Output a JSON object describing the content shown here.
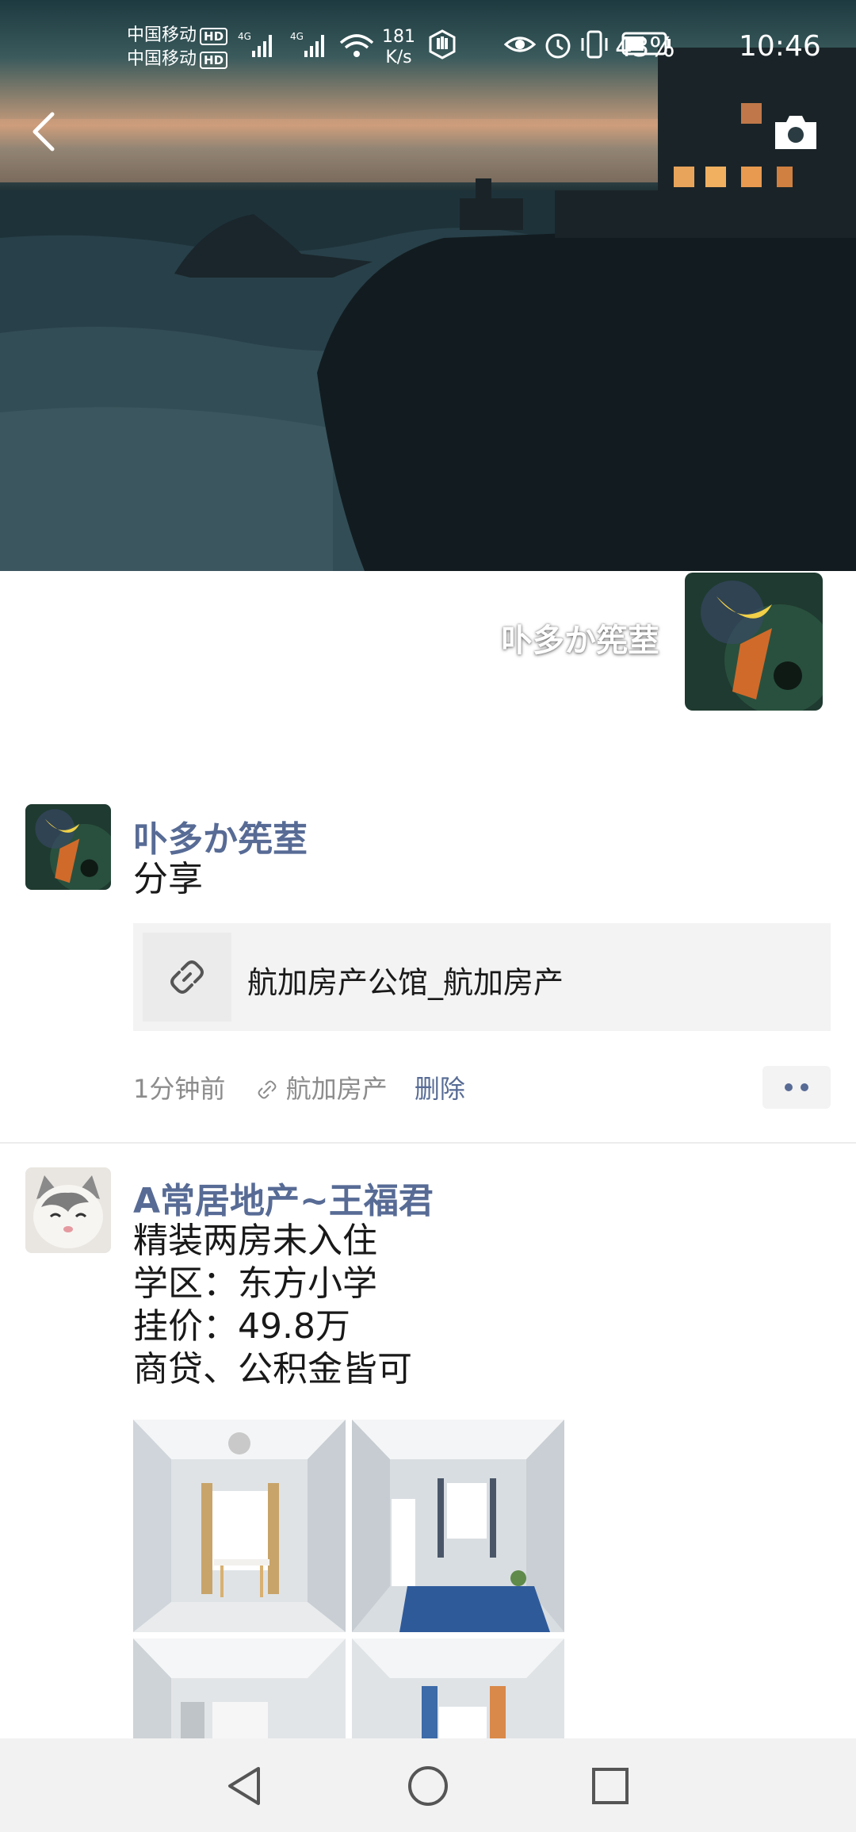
{
  "status_bar": {
    "carrier_1": "中国移动",
    "carrier_2": "中国移动",
    "hd_label": "HD",
    "signal_label": "4G",
    "net_speed_value": "181",
    "net_speed_unit": "K/s",
    "battery_percent": "43%",
    "time": "10:46"
  },
  "profile": {
    "name": "卟多か筅荎"
  },
  "posts": [
    {
      "author": "卟多か筅荎",
      "text": "分享",
      "link_title": "航加房产公馆_航加房产",
      "time": "1分钟前",
      "source": "航加房产",
      "delete_label": "删除"
    },
    {
      "author": "A常居地产~王福君",
      "lines": [
        "精装两房未入住",
        "学区：东方小学",
        "挂价：49.8万",
        "商贷、公积金皆可"
      ]
    }
  ],
  "icons": {
    "back": "chevron-left-icon",
    "camera": "camera-icon",
    "link": "link-icon",
    "more": "more-icon",
    "nav_back": "triangle-back-icon",
    "nav_home": "circle-home-icon",
    "nav_recents": "square-recents-icon"
  }
}
